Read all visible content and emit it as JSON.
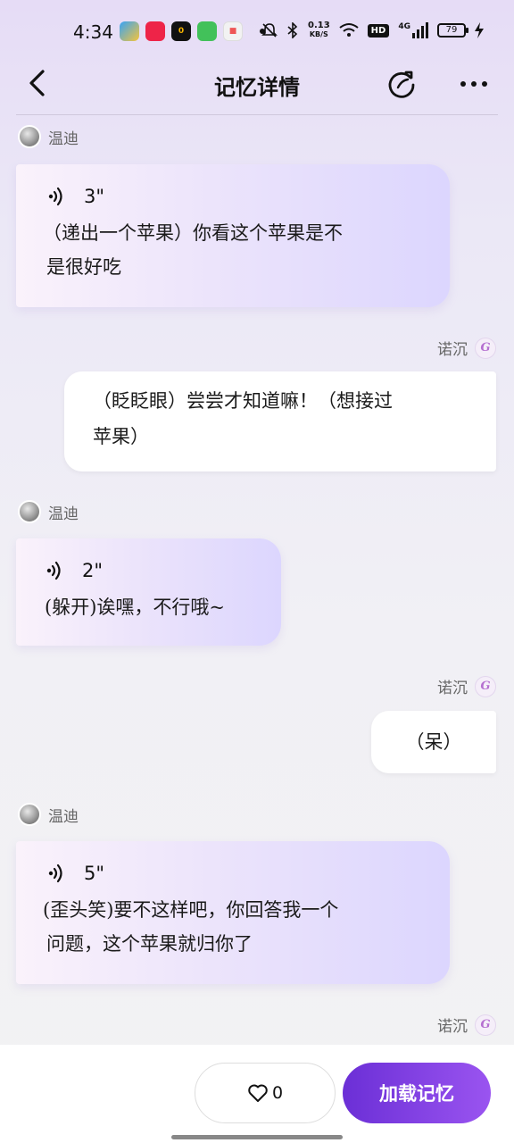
{
  "status_bar": {
    "time": "4:34",
    "network_speed": "0.13",
    "network_unit": "KB/S",
    "hd_label": "HD",
    "signal_label": "4G",
    "battery": "79",
    "app_icons": [
      "qq-browser-icon",
      "xiaohongshu-icon",
      "app-icon",
      "wechat-icon",
      "game-icon"
    ]
  },
  "header": {
    "title": "记忆详情"
  },
  "messages": [
    {
      "role": "ai",
      "sender": "温迪",
      "voice_duration": "3\"",
      "lines": [
        "（递出一个苹果）你看这个苹果是不",
        "是很好吃"
      ]
    },
    {
      "role": "user",
      "sender": "诺沉",
      "lines": [
        "（眨眨眼）尝尝才知道嘛！（想接过",
        "苹果）"
      ]
    },
    {
      "role": "ai",
      "sender": "温迪",
      "voice_duration": "2\"",
      "lines": [
        "(躲开)诶嘿，不行哦~"
      ]
    },
    {
      "role": "user",
      "sender": "诺沉",
      "lines": [
        "（呆）"
      ]
    },
    {
      "role": "ai",
      "sender": "温迪",
      "voice_duration": "5\"",
      "lines": [
        "(歪头笑)要不这样吧，你回答我一个",
        "问题，这个苹果就归你了"
      ]
    },
    {
      "role": "user",
      "sender": "诺沉",
      "lines": []
    }
  ],
  "bottom_bar": {
    "like_count": "0",
    "load_button_label": "加载记忆"
  },
  "colors": {
    "accent_start": "#6b2fd6",
    "accent_end": "#9a54f0"
  }
}
